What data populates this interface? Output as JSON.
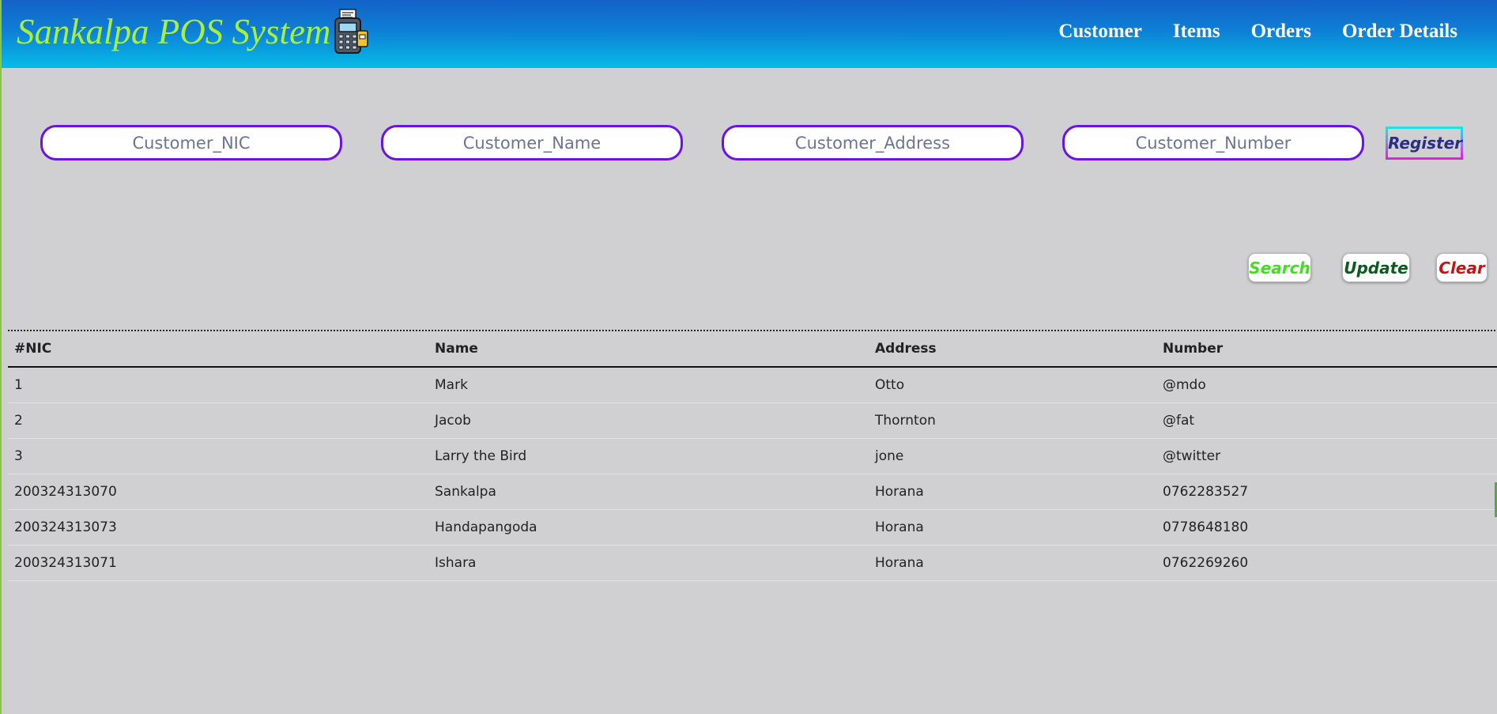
{
  "header": {
    "brand": "Sankalpa POS System",
    "brand_icon": "pos-terminal-icon",
    "nav": [
      {
        "label": "Customer"
      },
      {
        "label": "Items"
      },
      {
        "label": "Orders"
      },
      {
        "label": "Order Details"
      }
    ],
    "colors": {
      "brand_text": "#a9f03a",
      "gradient_top": "#1462c7",
      "gradient_bottom": "#05bde6"
    }
  },
  "form": {
    "nic_placeholder": "Customer_NIC",
    "name_placeholder": "Customer_Name",
    "address_placeholder": "Customer_Address",
    "number_placeholder": "Customer_Number",
    "register_label": "Register"
  },
  "actions": {
    "search_label": "Search",
    "update_label": "Update",
    "clear_label": "Clear"
  },
  "table": {
    "headers": [
      "#NIC",
      "Name",
      "Address",
      "Number"
    ],
    "rows": [
      [
        "1",
        "Mark",
        "Otto",
        "@mdo"
      ],
      [
        "2",
        "Jacob",
        "Thornton",
        "@fat"
      ],
      [
        "3",
        "Larry the Bird",
        "jone",
        "@twitter"
      ],
      [
        "200324313070",
        "Sankalpa",
        "Horana",
        "0762283527"
      ],
      [
        "200324313073",
        "Handapangoda",
        "Horana",
        "0778648180"
      ],
      [
        "200324313071",
        "Ishara",
        "Horana",
        "0762269260"
      ]
    ]
  }
}
